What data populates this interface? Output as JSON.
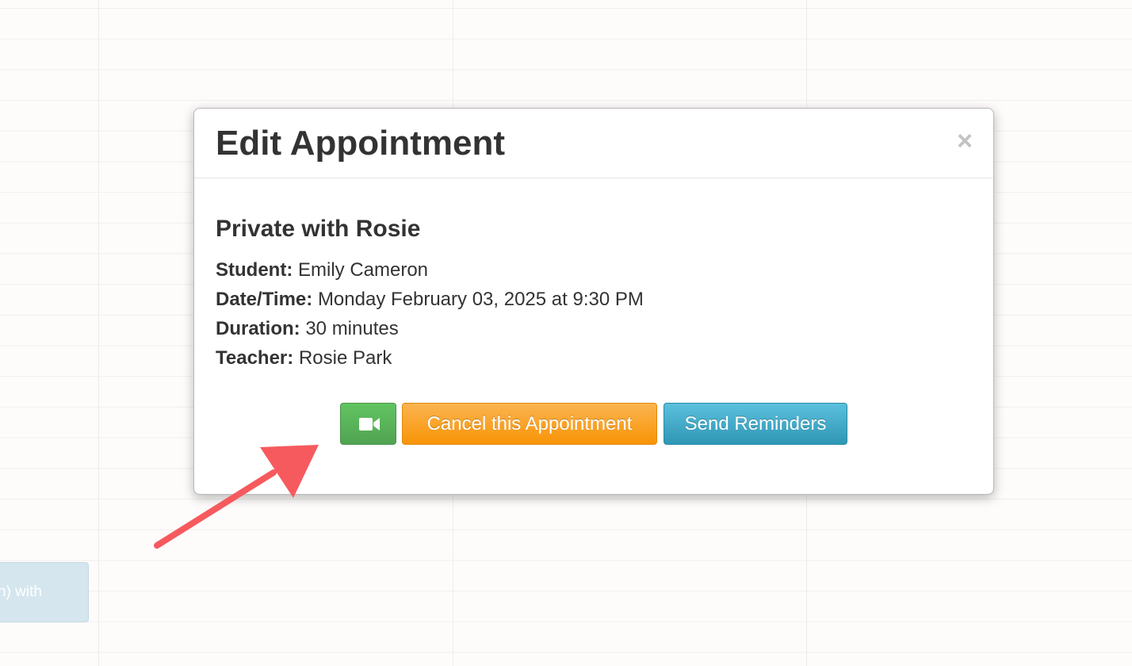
{
  "modal": {
    "title": "Edit Appointment",
    "close_label": "×",
    "appointment_title": "Private with Rosie",
    "details": [
      {
        "label": "Student:",
        "value": "Emily Cameron"
      },
      {
        "label": "Date/Time:",
        "value": "Monday February 03, 2025 at 9:30 PM"
      },
      {
        "label": "Duration:",
        "value": "30 minutes"
      },
      {
        "label": "Teacher:",
        "value": "Rosie Park"
      }
    ],
    "buttons": {
      "video_icon": "video-camera-icon",
      "cancel_label": "Cancel this Appointment",
      "reminders_label": "Send Reminders"
    }
  },
  "calendar": {
    "event_text": "n) with"
  },
  "colors": {
    "green_button": "#5bb75b",
    "orange_button": "#faa732",
    "blue_button": "#49afcd",
    "annotation_arrow": "#f65a5e"
  }
}
